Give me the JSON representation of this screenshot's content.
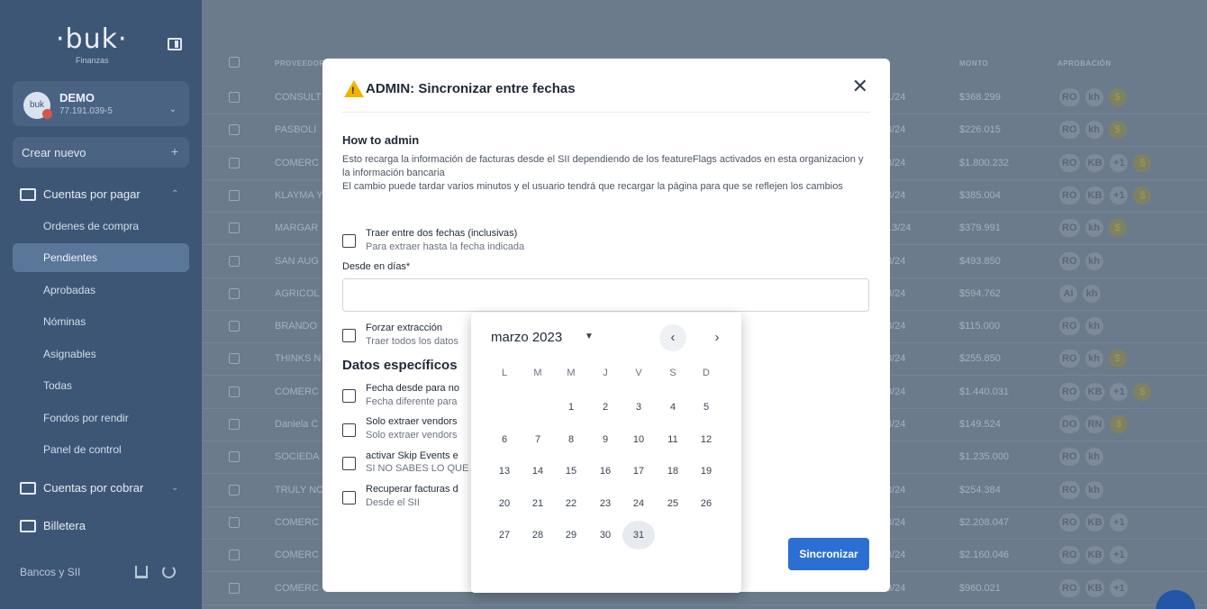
{
  "sidebar": {
    "logo": "·buk·",
    "logo_sub": "Finanzas",
    "account": {
      "avatar_text": "buk",
      "name": "DEMO",
      "rut": "77.191.039-5"
    },
    "create_label": "Crear nuevo",
    "cuentas_pagar": "Cuentas por pagar",
    "items": [
      {
        "label": "Ordenes de compra"
      },
      {
        "label": "Pendientes"
      },
      {
        "label": "Aprobadas"
      },
      {
        "label": "Nóminas"
      },
      {
        "label": "Asignables"
      },
      {
        "label": "Todas"
      },
      {
        "label": "Fondos por rendir"
      },
      {
        "label": "Panel de control"
      }
    ],
    "cuentas_cobrar": "Cuentas por cobrar",
    "billetera": "Billetera",
    "bancos": "Bancos y SII"
  },
  "table": {
    "headers": {
      "proveedor": "PROVEEDOR",
      "monto": "MONTO",
      "aprobacion": "APROBACIÓN"
    },
    "rows": [
      {
        "prov": "CONSULT",
        "fecha": "1/24",
        "monto": "$368.299",
        "chips": [
          "RO",
          "kh"
        ],
        "coin": true
      },
      {
        "prov": "PASBOLI",
        "fecha": "3/24",
        "monto": "$226.015",
        "chips": [
          "RO",
          "kh"
        ],
        "coin": true
      },
      {
        "prov": "COMERC",
        "fecha": "3/24",
        "monto": "$1.800.232",
        "chips": [
          "RO",
          "KB",
          "+1"
        ],
        "coin": true
      },
      {
        "prov": "KLAYMA Y",
        "fecha": "3/24",
        "monto": "$385.004",
        "chips": [
          "RO",
          "KB",
          "+1"
        ],
        "coin": true
      },
      {
        "prov": "MARGAR",
        "fecha": "13/24",
        "monto": "$379.991",
        "chips": [
          "RO",
          "kh"
        ],
        "coin": true
      },
      {
        "prov": "SAN AUG",
        "fecha": "3/24",
        "monto": "$493.850",
        "chips": [
          "RO",
          "kh"
        ],
        "coin": false
      },
      {
        "prov": "AGRICOL",
        "fecha": "3/24",
        "monto": "$594.762",
        "chips": [
          "AI",
          "kh"
        ],
        "coin": false
      },
      {
        "prov": "BRANDO",
        "fecha": "3/24",
        "monto": "$115.000",
        "chips": [
          "RO",
          "kh"
        ],
        "coin": false
      },
      {
        "prov": "THINKS N",
        "fecha": "3/24",
        "monto": "$255.850",
        "chips": [
          "RO",
          "kh"
        ],
        "coin": true
      },
      {
        "prov": "COMERC",
        "fecha": "3/24",
        "monto": "$1.440.031",
        "chips": [
          "RO",
          "KB",
          "+1"
        ],
        "coin": true
      },
      {
        "prov": "Daniela C",
        "fecha": "4/24",
        "monto": "$149.524",
        "chips": [
          "DO",
          "RN"
        ],
        "coin": true
      },
      {
        "prov": "SOCIEDA",
        "fecha": "",
        "monto": "$1.235.000",
        "chips": [
          "RO",
          "kh"
        ],
        "coin": false
      },
      {
        "prov": "TRULY NC",
        "fecha": "3/24",
        "monto": "$254.384",
        "chips": [
          "RO",
          "kh"
        ],
        "coin": false
      },
      {
        "prov": "COMERC",
        "fecha": "3/24",
        "monto": "$2.208.047",
        "chips": [
          "RO",
          "KB",
          "+1"
        ],
        "coin": false
      },
      {
        "prov": "COMERC",
        "fecha": "3/24",
        "monto": "$2.160.046",
        "chips": [
          "RO",
          "KB",
          "+1"
        ],
        "coin": false
      },
      {
        "prov": "COMERC",
        "fecha": "3/24",
        "monto": "$960.021",
        "chips": [
          "RO",
          "KB",
          "+1"
        ],
        "coin": false
      }
    ]
  },
  "modal": {
    "title": "ADMIN: Sincronizar entre fechas",
    "how_title": "How to admin",
    "how_text_1": "Esto recarga la información de facturas desde el SII dependiendo de los featureFlags activados en esta organizacion y la información bancaria",
    "how_text_2": "El cambio puede tardar varios minutos y el usuario tendrá que recargar la página para que se reflejen los cambios",
    "opt_rango_label": "Traer entre dos fechas (inclusivas)",
    "opt_rango_sub": "Para extraer hasta la fecha indicada",
    "desde_label": "Desde en días*",
    "desde_value": "",
    "opt_forzar_label": "Forzar extracción",
    "opt_forzar_sub": "Traer todos los datos",
    "section_title": "Datos específicos",
    "options": [
      {
        "label": "Fecha desde para no",
        "sub": "Fecha diferente para"
      },
      {
        "label": "Solo extraer vendors",
        "sub": "Solo extraer vendors"
      },
      {
        "label": "activar Skip Events e",
        "sub": "SI NO SABES LO QUE"
      },
      {
        "label": "Recuperar facturas d",
        "sub": "Desde el SII"
      }
    ],
    "sync_button": "Sincronizar"
  },
  "datepicker": {
    "month_label": "marzo 2023",
    "weekdays": [
      "L",
      "M",
      "M",
      "J",
      "V",
      "S",
      "D"
    ],
    "first_weekday_index": 2,
    "days_in_month": 31,
    "selected_day": 31
  }
}
